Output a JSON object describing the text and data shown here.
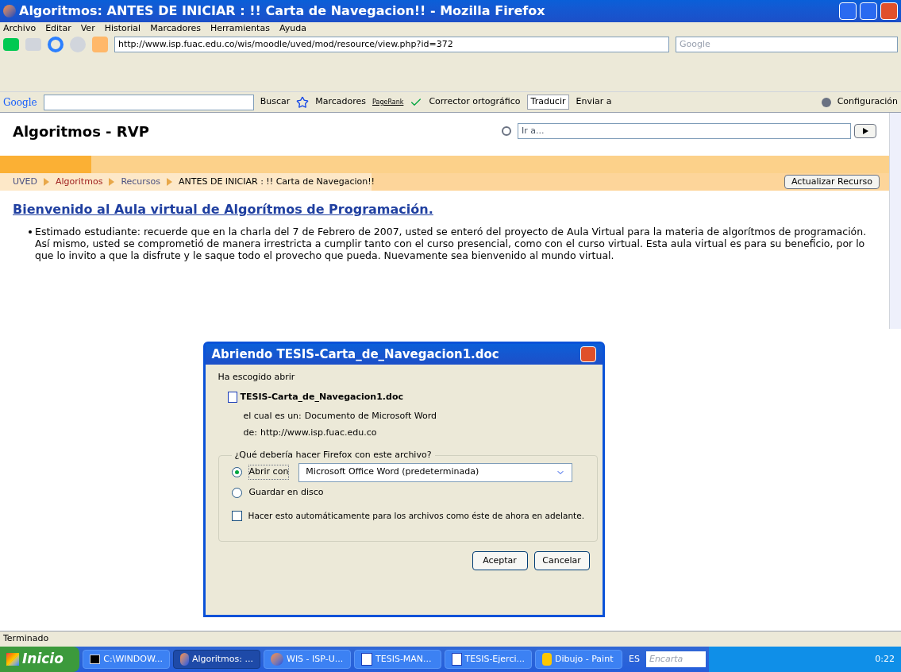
{
  "window": {
    "title": "Algoritmos: ANTES DE INICIAR : !! Carta de Navegacion!! - Mozilla Firefox"
  },
  "menu": [
    "Archivo",
    "Editar",
    "Ver",
    "Historial",
    "Marcadores",
    "Herramientas",
    "Ayuda"
  ],
  "navigation": {
    "url": "http://www.isp.fuac.edu.co/wis/moodle/uved/mod/resource/view.php?id=372",
    "search_placeholder": "Google"
  },
  "google_toolbar": {
    "logo": "Google",
    "search_button": "Buscar",
    "bookmarks": "Marcadores",
    "pagerank": "PageRank",
    "spellcheck": "Corrector ortográfico",
    "translate": "Traducir",
    "send": "Enviar a",
    "settings": "Configuración"
  },
  "page": {
    "site_title": "Algoritmos - RVP",
    "jump_placeholder": "Ir a...",
    "breadcrumb": [
      {
        "label": "UVED",
        "kind": "link",
        "visited": false
      },
      {
        "label": "Algoritmos",
        "kind": "link",
        "visited": true
      },
      {
        "label": "Recursos",
        "kind": "link",
        "visited": false
      },
      {
        "label": "ANTES DE INICIAR : !! Carta de Navegacion!!",
        "kind": "current",
        "visited": false
      }
    ],
    "update_button": "Actualizar Recurso",
    "heading": "Bienvenido al Aula virtual de Algorítmos de Programación.",
    "bullets": [
      "Estimado estudiante: recuerde que en la charla del 7 de Febrero de 2007, usted se enteró del proyecto de Aula Virtual para la materia de algorítmos de programación. Así mismo, usted se comprometió de manera irrestricta a cumplir tanto con el curso presencial, como con el curso virtual. Esta aula virtual es para su beneficio, por lo que lo invito a que la disfrute y le saque todo el provecho que pueda. Nuevamente sea bienvenido al mundo virtual."
    ]
  },
  "dialog": {
    "title": "Abriendo TESIS-Carta_de_Navegacion1.doc",
    "intro": "Ha escogido abrir",
    "file_name": "TESIS-Carta_de_Navegacion1.doc",
    "type_label": "el cual es un:",
    "type_value": "Documento de Microsoft Word",
    "from_label": "de:",
    "from_value": "http://www.isp.fuac.edu.co",
    "group_legend": "¿Qué debería hacer Firefox con este archivo?",
    "options": [
      {
        "kind": "open",
        "label": "Abrir con",
        "selected": true
      },
      {
        "kind": "save",
        "label": "Guardar en disco",
        "selected": false
      }
    ],
    "application": "Microsoft Office Word (predeterminada)",
    "remember": {
      "label": "Hacer esto automáticamente para los archivos como éste de ahora en adelante.",
      "checked": false
    },
    "buttons": [
      "Aceptar",
      "Cancelar"
    ]
  },
  "status_bar": "Terminado",
  "taskbar": {
    "start": "Inicio",
    "tasks": [
      {
        "label": "C:\\WINDOW...",
        "kind": "console",
        "selected": false
      },
      {
        "label": "Algoritmos: ...",
        "kind": "firefox",
        "selected": true
      },
      {
        "label": "WIS - ISP-U...",
        "kind": "firefox",
        "selected": false
      },
      {
        "label": "TESIS-MAN...",
        "kind": "word",
        "selected": false
      },
      {
        "label": "TESIS-Ejerci...",
        "kind": "word",
        "selected": false
      },
      {
        "label": "Dibujo - Paint",
        "kind": "paint",
        "selected": false
      }
    ],
    "language": "ES",
    "search_placeholder": "Encarta",
    "clock": "0:22"
  }
}
